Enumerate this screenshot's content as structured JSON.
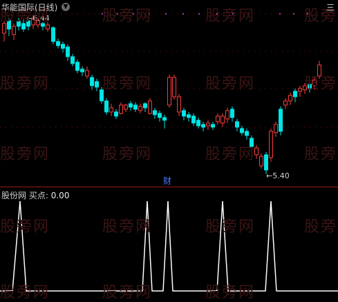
{
  "main_panel": {
    "title": "华能国际(日线)",
    "high_label": "6.44",
    "low_label": "5.40",
    "cai_label": "财",
    "corner_glyph": "三",
    "colors": {
      "up": "#ff3c3c",
      "down": "#00e5e5",
      "divider": "#a01818",
      "gridline": "#7a1010"
    }
  },
  "sub_panel": {
    "indicator_name": "股份网",
    "buy_label": "买点",
    "value": "0.00",
    "line_color": "#ffffff",
    "signal_count": 5
  },
  "watermark": "股旁网",
  "icons": {
    "collapse_main": "chevron-down-icon",
    "collapse_sub": "chevron-down-icon",
    "corner": "panel-layout-icon"
  }
}
